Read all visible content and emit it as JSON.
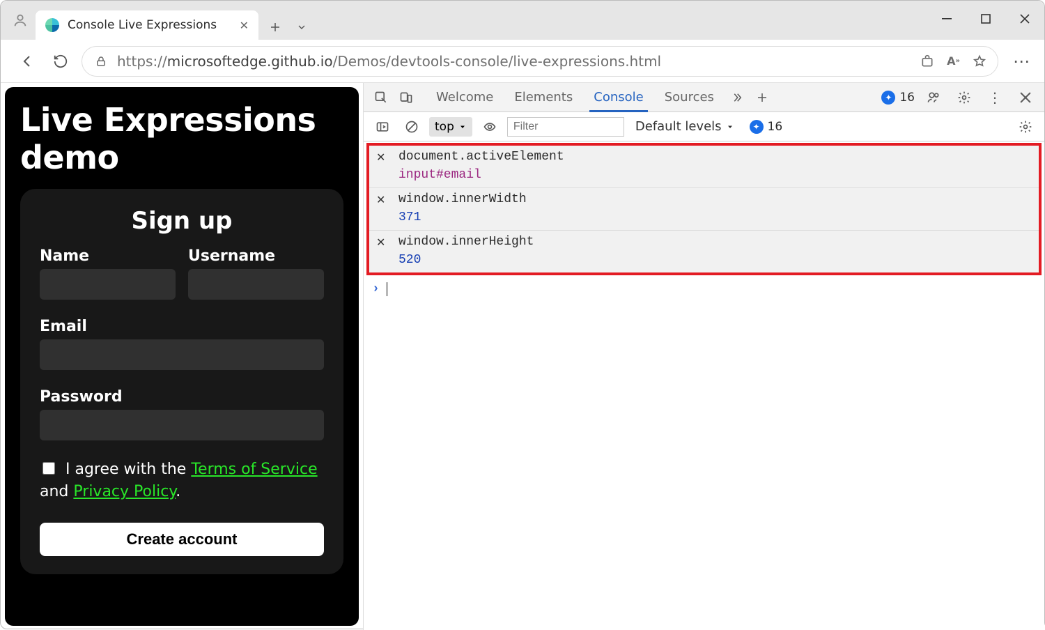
{
  "browser": {
    "tab_title": "Console Live Expressions",
    "url_prefix": "https://",
    "url_host": "microsoftedge.github.io",
    "url_path": "/Demos/devtools-console/live-expressions.html"
  },
  "page": {
    "heading": "Live Expressions demo",
    "signup_heading": "Sign up",
    "labels": {
      "name": "Name",
      "username": "Username",
      "email": "Email",
      "password": "Password"
    },
    "agree_pre": "I agree with the ",
    "tos": "Terms of Service",
    "agree_mid": " and ",
    "privacy": "Privacy Policy",
    "agree_post": ".",
    "create_button": "Create account"
  },
  "devtools": {
    "tabs": {
      "welcome": "Welcome",
      "elements": "Elements",
      "console": "Console",
      "sources": "Sources"
    },
    "issues_count": "16",
    "toolbar": {
      "context": "top",
      "filter_placeholder": "Filter",
      "levels_label": "Default levels",
      "issues_count": "16"
    },
    "live_expressions": [
      {
        "expr": "document.activeElement",
        "value": "input#email",
        "valueKind": "purple"
      },
      {
        "expr": "window.innerWidth",
        "value": "371",
        "valueKind": "blue"
      },
      {
        "expr": "window.innerHeight",
        "value": "520",
        "valueKind": "blue"
      }
    ]
  }
}
